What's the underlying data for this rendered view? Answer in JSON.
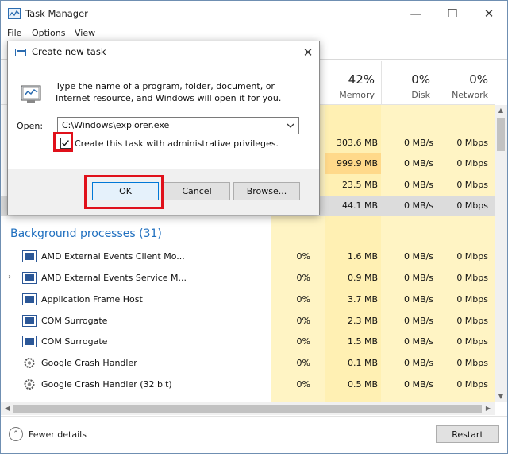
{
  "window": {
    "title": "Task Manager",
    "minimize": "—",
    "maximize": "☐",
    "close": "✕"
  },
  "menu": {
    "file": "File",
    "options": "Options",
    "view": "View"
  },
  "columns": {
    "memory": {
      "pct": "42%",
      "label": "Memory"
    },
    "disk": {
      "pct": "0%",
      "label": "Disk"
    },
    "network": {
      "pct": "0%",
      "label": "Network"
    }
  },
  "app_rows": [
    {
      "memory": "303.6 MB",
      "disk": "0 MB/s",
      "network": "0 Mbps"
    },
    {
      "memory": "999.9 MB",
      "disk": "0 MB/s",
      "network": "0 Mbps"
    },
    {
      "memory": "23.5 MB",
      "disk": "0 MB/s",
      "network": "0 Mbps"
    },
    {
      "memory": "44.1 MB",
      "disk": "0 MB/s",
      "network": "0 Mbps"
    }
  ],
  "background": {
    "title": "Background processes (31)",
    "rows": [
      {
        "name": "AMD External Events Client Mo...",
        "cpu": "0%",
        "memory": "1.6 MB",
        "disk": "0 MB/s",
        "network": "0 Mbps",
        "icon": "service-icon"
      },
      {
        "name": "AMD External Events Service M...",
        "cpu": "0%",
        "memory": "0.9 MB",
        "disk": "0 MB/s",
        "network": "0 Mbps",
        "icon": "service-icon"
      },
      {
        "name": "Application Frame Host",
        "cpu": "0%",
        "memory": "3.7 MB",
        "disk": "0 MB/s",
        "network": "0 Mbps",
        "icon": "service-icon"
      },
      {
        "name": "COM Surrogate",
        "cpu": "0%",
        "memory": "2.3 MB",
        "disk": "0 MB/s",
        "network": "0 Mbps",
        "icon": "service-icon"
      },
      {
        "name": "COM Surrogate",
        "cpu": "0%",
        "memory": "1.5 MB",
        "disk": "0 MB/s",
        "network": "0 Mbps",
        "icon": "service-icon"
      },
      {
        "name": "Google Crash Handler",
        "cpu": "0%",
        "memory": "0.1 MB",
        "disk": "0 MB/s",
        "network": "0 Mbps",
        "icon": "gear-icon"
      },
      {
        "name": "Google Crash Handler (32 bit)",
        "cpu": "0%",
        "memory": "0.5 MB",
        "disk": "0 MB/s",
        "network": "0 Mbps",
        "icon": "gear-icon"
      }
    ]
  },
  "footer": {
    "fewer_details": "Fewer details",
    "restart": "Restart"
  },
  "dialog": {
    "title": "Create new task",
    "close": "✕",
    "description": "Type the name of a program, folder, document, or Internet resource, and Windows will open it for you.",
    "open_label": "Open:",
    "open_value": "C:\\Windows\\explorer.exe",
    "checkbox_label": "Create this task with administrative privileges.",
    "checkbox_checked": true,
    "ok": "OK",
    "cancel": "Cancel",
    "browse": "Browse..."
  },
  "colors": {
    "highlight": "#e0101a",
    "accent": "#1f6fbf",
    "cell_yellow": "#fff4c4",
    "cell_orange": "#ffd98a"
  }
}
